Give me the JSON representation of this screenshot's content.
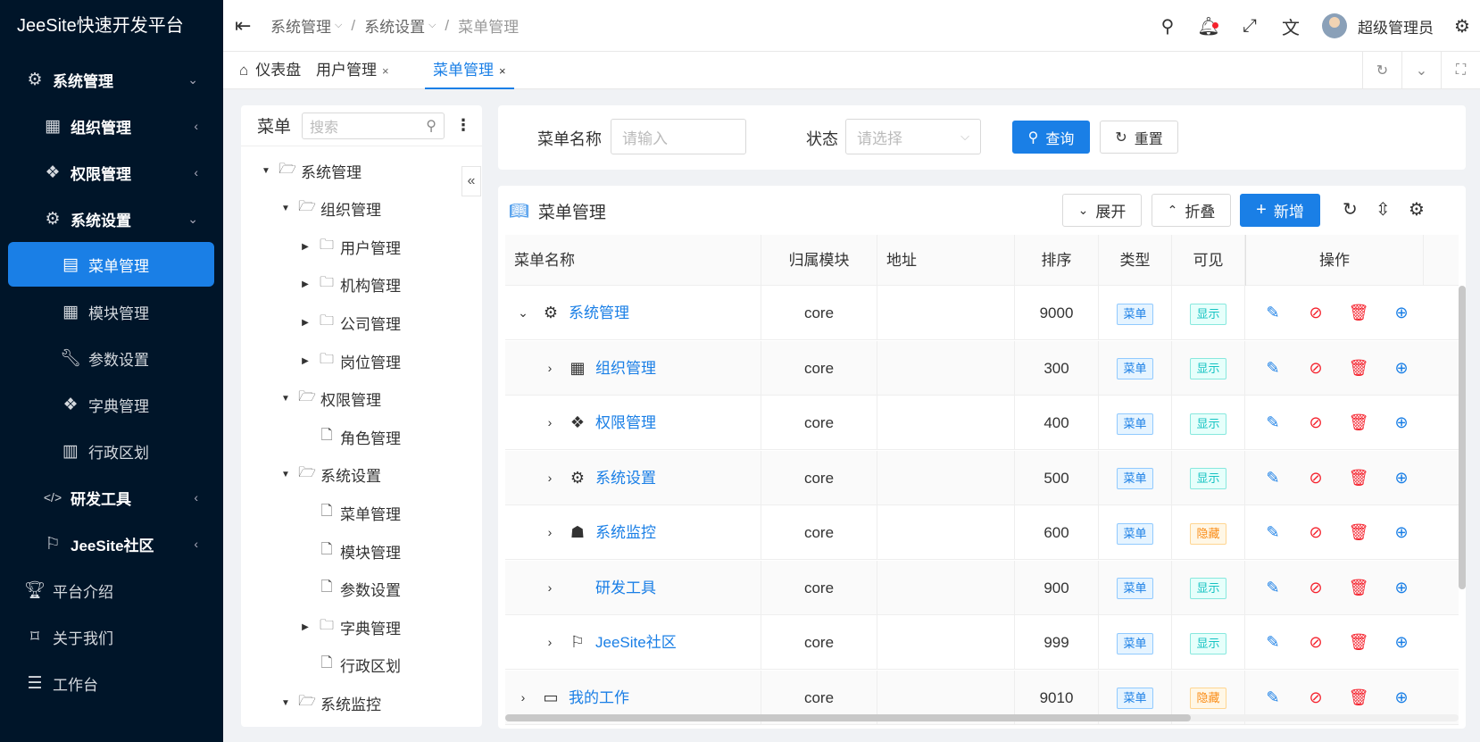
{
  "app": {
    "title": "JeeSite快速开发平台"
  },
  "sidebar": {
    "items": [
      {
        "label": "系统管理",
        "icon": "gear-icon",
        "arrow": "⌄"
      },
      {
        "label": "组织管理",
        "icon": "grid-icon",
        "arrow": "‹"
      },
      {
        "label": "权限管理",
        "icon": "layers-icon",
        "arrow": "‹"
      },
      {
        "label": "系统设置",
        "icon": "gear-icon",
        "arrow": "⌄"
      },
      {
        "label": "菜单管理",
        "icon": "book-icon"
      },
      {
        "label": "模块管理",
        "icon": "grid-icon"
      },
      {
        "label": "参数设置",
        "icon": "wrench-icon"
      },
      {
        "label": "字典管理",
        "icon": "layers-icon"
      },
      {
        "label": "行政区划",
        "icon": "map-icon"
      },
      {
        "label": "研发工具",
        "icon": "code-icon",
        "arrow": "‹"
      },
      {
        "label": "JeeSite社区",
        "icon": "signpost-icon",
        "arrow": "‹"
      },
      {
        "label": "平台介绍",
        "icon": "trophy-icon"
      },
      {
        "label": "关于我们",
        "icon": "tag-icon"
      },
      {
        "label": "工作台",
        "icon": "reader-icon"
      }
    ]
  },
  "header": {
    "breadcrumb": [
      "系统管理",
      "系统设置",
      "菜单管理"
    ],
    "user_name": "超级管理员"
  },
  "tabs": [
    {
      "label": "仪表盘"
    },
    {
      "label": "用户管理",
      "close": "×"
    },
    {
      "label": "菜单管理",
      "close": "×"
    }
  ],
  "tree": {
    "title": "菜单",
    "search_placeholder": "搜索",
    "nodes": [
      {
        "label": "系统管理",
        "toggle": "▼",
        "type": "folder-open"
      },
      {
        "label": "组织管理",
        "toggle": "▼",
        "type": "folder-open"
      },
      {
        "label": "用户管理",
        "toggle": "▶",
        "type": "folder"
      },
      {
        "label": "机构管理",
        "toggle": "▶",
        "type": "folder"
      },
      {
        "label": "公司管理",
        "toggle": "▶",
        "type": "folder"
      },
      {
        "label": "岗位管理",
        "toggle": "▶",
        "type": "folder"
      },
      {
        "label": "权限管理",
        "toggle": "▼",
        "type": "folder-open"
      },
      {
        "label": "角色管理",
        "toggle": "",
        "type": "file"
      },
      {
        "label": "系统设置",
        "toggle": "▼",
        "type": "folder-open"
      },
      {
        "label": "菜单管理",
        "toggle": "",
        "type": "file"
      },
      {
        "label": "模块管理",
        "toggle": "",
        "type": "file"
      },
      {
        "label": "参数设置",
        "toggle": "",
        "type": "file"
      },
      {
        "label": "字典管理",
        "toggle": "▶",
        "type": "folder"
      },
      {
        "label": "行政区划",
        "toggle": "",
        "type": "file"
      },
      {
        "label": "系统监控",
        "toggle": "▼",
        "type": "folder-open"
      }
    ]
  },
  "filter": {
    "name_label": "菜单名称",
    "name_placeholder": "请输入",
    "status_label": "状态",
    "status_placeholder": "请选择",
    "query_label": "查询",
    "reset_label": "重置"
  },
  "table": {
    "title": "菜单管理",
    "expand_label": "展开",
    "collapse_label": "折叠",
    "add_label": "新增",
    "columns": [
      "菜单名称",
      "归属模块",
      "地址",
      "排序",
      "类型",
      "可见",
      "操作"
    ],
    "rows": [
      {
        "name": "系统管理",
        "icon": "gear-icon",
        "module": "core",
        "address": "",
        "sort": "9000",
        "type": "菜单",
        "visible": "显示",
        "visible_status": "show",
        "level": 0
      },
      {
        "name": "组织管理",
        "icon": "grid-icon",
        "module": "core",
        "address": "",
        "sort": "300",
        "type": "菜单",
        "visible": "显示",
        "visible_status": "show",
        "level": 1
      },
      {
        "name": "权限管理",
        "icon": "layers-icon",
        "module": "core",
        "address": "",
        "sort": "400",
        "type": "菜单",
        "visible": "显示",
        "visible_status": "show",
        "level": 1
      },
      {
        "name": "系统设置",
        "icon": "gear-icon",
        "module": "core",
        "address": "",
        "sort": "500",
        "type": "菜单",
        "visible": "显示",
        "visible_status": "show",
        "level": 1
      },
      {
        "name": "系统监控",
        "icon": "ghost-icon",
        "module": "core",
        "address": "",
        "sort": "600",
        "type": "菜单",
        "visible": "隐藏",
        "visible_status": "hide",
        "level": 1
      },
      {
        "name": "研发工具",
        "icon": "code-icon",
        "module": "core",
        "address": "",
        "sort": "900",
        "type": "菜单",
        "visible": "显示",
        "visible_status": "show",
        "level": 1
      },
      {
        "name": "JeeSite社区",
        "icon": "signpost-icon",
        "module": "core",
        "address": "",
        "sort": "999",
        "type": "菜单",
        "visible": "显示",
        "visible_status": "show",
        "level": 1
      },
      {
        "name": "我的工作",
        "icon": "monitor-icon",
        "module": "core",
        "address": "",
        "sort": "9010",
        "type": "菜单",
        "visible": "隐藏",
        "visible_status": "hide",
        "level": 0
      }
    ]
  },
  "colors": {
    "primary": "#1a7fe6",
    "sidebar_bg": "#001529",
    "danger": "#f5222d",
    "show_tag": "#13c2c2",
    "hide_tag": "#fa8c16"
  }
}
